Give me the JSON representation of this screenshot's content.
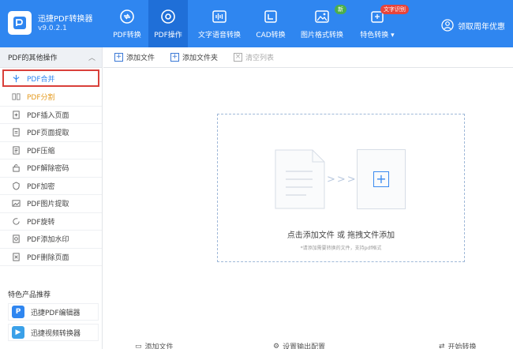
{
  "app": {
    "title": "迅捷PDF转换器",
    "version": "v9.0.2.1",
    "brand_color": "#2f86f0"
  },
  "nav": [
    {
      "label": "PDF转换",
      "icon": "convert-icon",
      "active": false
    },
    {
      "label": "PDF操作",
      "icon": "gear-icon",
      "active": true
    },
    {
      "label": "文字语音转换",
      "icon": "audio-icon",
      "active": false
    },
    {
      "label": "CAD转换",
      "icon": "cad-icon",
      "active": false
    },
    {
      "label": "图片格式转换",
      "icon": "image-icon",
      "active": false,
      "badge": "新",
      "badge_color": "#4cae4c"
    },
    {
      "label": "特色转换",
      "icon": "special-icon",
      "active": false,
      "badge": "文字识别",
      "badge_color": "#e8443a",
      "has_dropdown": true
    }
  ],
  "promo": {
    "label": "领取周年优惠",
    "icon": "user-circle-icon"
  },
  "sidebar": {
    "header": "PDF的其他操作",
    "items": [
      {
        "label": "PDF合并",
        "icon": "merge-icon"
      },
      {
        "label": "PDF分割",
        "icon": "split-icon"
      },
      {
        "label": "PDF插入页面",
        "icon": "insert-page-icon"
      },
      {
        "label": "PDF页面提取",
        "icon": "extract-page-icon"
      },
      {
        "label": "PDF压缩",
        "icon": "compress-icon"
      },
      {
        "label": "PDF解除密码",
        "icon": "unlock-icon"
      },
      {
        "label": "PDF加密",
        "icon": "shield-icon"
      },
      {
        "label": "PDF图片提取",
        "icon": "image-extract-icon"
      },
      {
        "label": "PDF旋转",
        "icon": "rotate-icon"
      },
      {
        "label": "PDF添加水印",
        "icon": "watermark-icon"
      },
      {
        "label": "PDF删除页面",
        "icon": "delete-page-icon"
      }
    ],
    "featured_title": "特色产品推荐",
    "products": [
      {
        "label": "迅捷PDF编辑器",
        "icon": "pdf-editor-icon",
        "color": "#2f86f0"
      },
      {
        "label": "迅捷视频转换器",
        "icon": "video-converter-icon",
        "color": "#3aa0e8"
      }
    ]
  },
  "toolbar": {
    "add_file": "添加文件",
    "add_folder": "添加文件夹",
    "clear_list": "清空列表"
  },
  "dropzone": {
    "main_text": "点击添加文件 或 拖拽文件添加",
    "sub_text": "*请添加需要转换的文件，支持pdf格式"
  },
  "bottom": {
    "add_file": "添加文件",
    "output_settings": "设置输出配置",
    "start": "开始转换"
  }
}
